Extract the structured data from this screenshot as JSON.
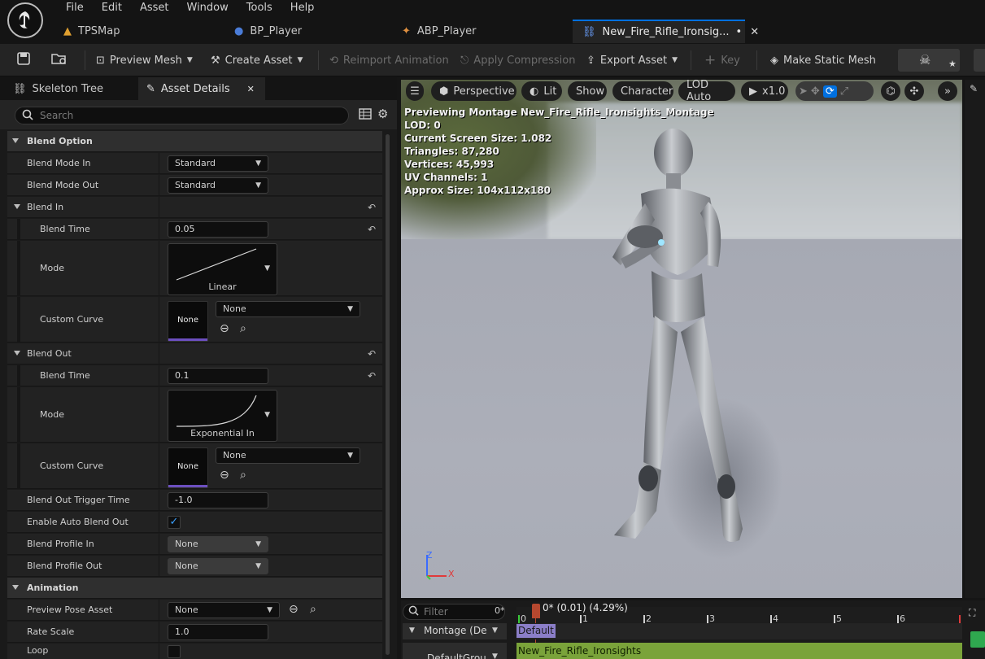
{
  "menu": [
    "File",
    "Edit",
    "Asset",
    "Window",
    "Tools",
    "Help"
  ],
  "doc_tabs": [
    {
      "label": "TPSMap",
      "active": false
    },
    {
      "label": "BP_Player",
      "active": false
    },
    {
      "label": "ABP_Player",
      "active": false
    },
    {
      "label": "New_Fire_Rifle_Ironsig...",
      "suffix": "•",
      "close": "✕",
      "active": true
    }
  ],
  "toolbar": {
    "preview_mesh": "Preview Mesh",
    "create_asset": "Create Asset",
    "reimport": "Reimport Animation",
    "apply_compression": "Apply Compression",
    "export_asset": "Export Asset",
    "key": "Key",
    "make_static_mesh": "Make Static Mesh"
  },
  "panel_tabs": {
    "skeleton_tree": "Skeleton Tree",
    "asset_details": "Asset Details",
    "close": "✕"
  },
  "search": {
    "placeholder": "Search"
  },
  "props": {
    "blend_option": "Blend Option",
    "blend_mode_in": {
      "label": "Blend Mode In",
      "value": "Standard"
    },
    "blend_mode_out": {
      "label": "Blend Mode Out",
      "value": "Standard"
    },
    "blend_in": "Blend In",
    "blend_in_time": {
      "label": "Blend Time",
      "value": "0.05"
    },
    "blend_in_mode": {
      "label": "Mode",
      "value": "Linear"
    },
    "blend_in_curve": {
      "label": "Custom Curve",
      "thumb": "None",
      "value": "None"
    },
    "blend_out": "Blend Out",
    "blend_out_time": {
      "label": "Blend Time",
      "value": "0.1"
    },
    "blend_out_mode": {
      "label": "Mode",
      "value": "Exponential In"
    },
    "blend_out_curve": {
      "label": "Custom Curve",
      "thumb": "None",
      "value": "None"
    },
    "blend_out_trigger": {
      "label": "Blend Out Trigger Time",
      "value": "-1.0"
    },
    "auto_blend_out": {
      "label": "Enable Auto Blend Out",
      "checked": true
    },
    "blend_profile_in": {
      "label": "Blend Profile In",
      "value": "None"
    },
    "blend_profile_out": {
      "label": "Blend Profile Out",
      "value": "None"
    },
    "animation": "Animation",
    "preview_pose": {
      "label": "Preview Pose Asset",
      "value": "None"
    },
    "rate_scale": {
      "label": "Rate Scale",
      "value": "1.0"
    },
    "loop": {
      "label": "Loop"
    }
  },
  "viewport": {
    "perspective": "Perspective",
    "lit": "Lit",
    "show": "Show",
    "character": "Character",
    "lod": "LOD Auto",
    "speed": "x1.0",
    "stats": [
      "Previewing Montage New_Fire_Rifle_Ironsights_Montage",
      "LOD: 0",
      "Current Screen Size: 1.082",
      "Triangles: 87,280",
      "Vertices: 45,993",
      "UV Channels: 1",
      "Approx Size: 104x112x180"
    ],
    "axis_z": "Z",
    "axis_x": "X"
  },
  "timeline": {
    "filter_placeholder": "Filter",
    "frame_zero": "0*",
    "playhead_readout": "0* (0.01) (4.29%)",
    "ticks": [
      "0",
      "1",
      "2",
      "3",
      "4",
      "5",
      "6"
    ],
    "montage_label": "Montage (De",
    "default_section": "Default",
    "default_group": "DefaultGrou",
    "segment_label": "New_Fire_Rifle_Ironsights"
  },
  "colors": {
    "accent": "#0070e0",
    "segment_green": "#7aa33a",
    "section_purple": "#8b7ec8",
    "curve_bar": "#6c4fc0",
    "playhead": "#b6482f"
  }
}
